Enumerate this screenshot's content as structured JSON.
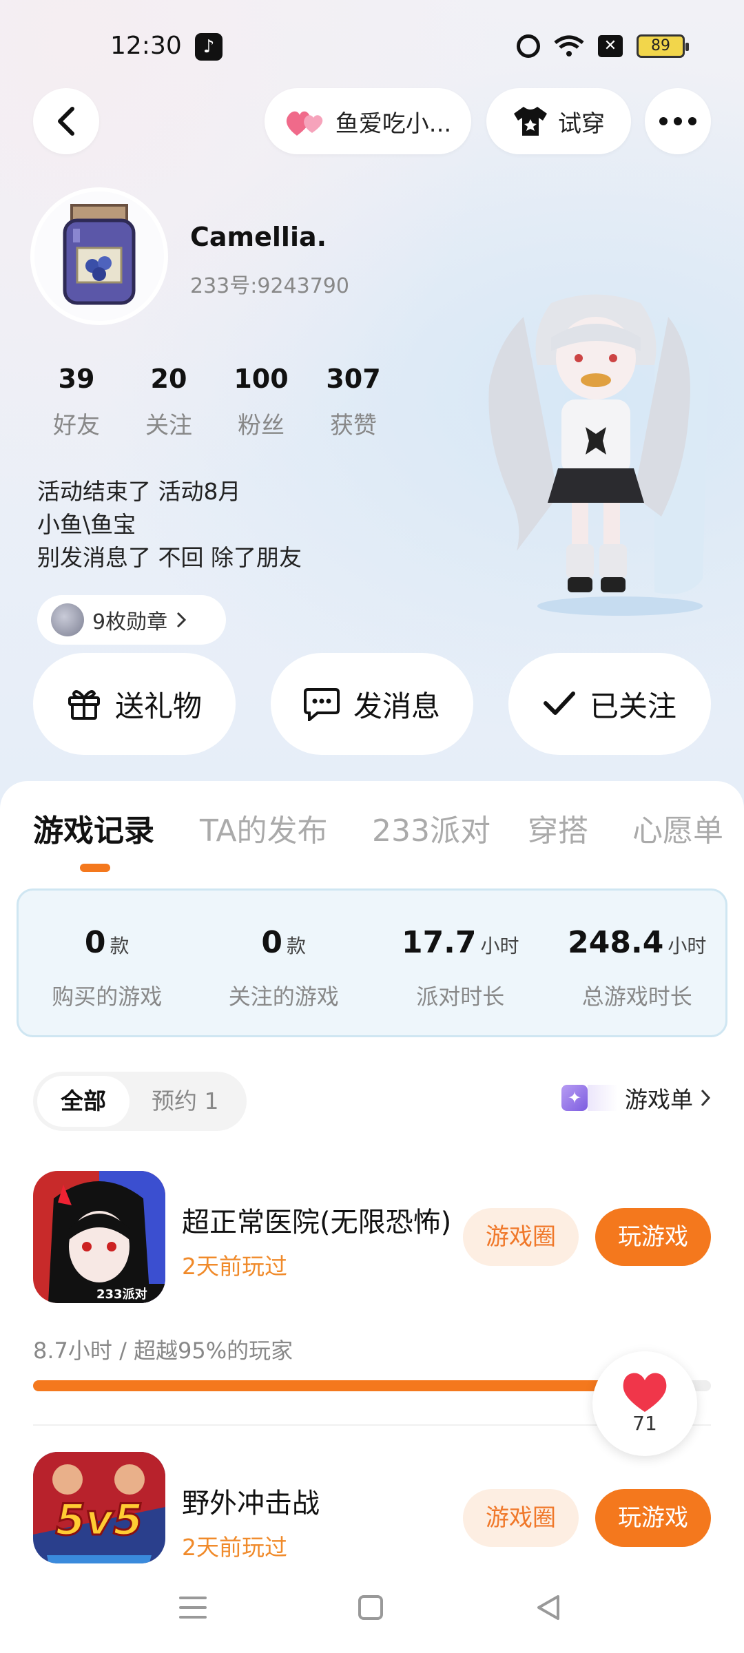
{
  "status_bar": {
    "time": "12:30",
    "battery": "89"
  },
  "top_bar": {
    "nickname_chip": "鱼爱吃小...",
    "try_on": "试穿"
  },
  "profile": {
    "name": "Camellia.",
    "uid": "233号:9243790",
    "stats": [
      {
        "value": "39",
        "label": "好友"
      },
      {
        "value": "20",
        "label": "关注"
      },
      {
        "value": "100",
        "label": "粉丝"
      },
      {
        "value": "307",
        "label": "获赞"
      }
    ],
    "bio": [
      "活动结束了 活动8月",
      "小鱼\\鱼宝",
      "别发消息了 不回 除了朋友"
    ],
    "badges": "9枚勋章"
  },
  "actions": {
    "gift": "送礼物",
    "message": "发消息",
    "followed": "已关注"
  },
  "tabs": [
    "游戏记录",
    "TA的发布",
    "233派对",
    "穿搭",
    "心愿单"
  ],
  "summary": [
    {
      "value": "0",
      "unit": "款",
      "label": "购买的游戏"
    },
    {
      "value": "0",
      "unit": "款",
      "label": "关注的游戏"
    },
    {
      "value": "17.7",
      "unit": "小时",
      "label": "派对时长"
    },
    {
      "value": "248.4",
      "unit": "小时",
      "label": "总游戏时长"
    }
  ],
  "filter": {
    "all": "全部",
    "reserve": "预约 1",
    "game_list": "游戏单"
  },
  "games": [
    {
      "title": "超正常医院(无限恐怖)",
      "last_played": "2天前玩过",
      "circle": "游戏圈",
      "play": "玩游戏",
      "icon_badge": "233派对",
      "play_stat": "8.7小时 / 超越95%的玩家",
      "progress": 0.95
    },
    {
      "title": "野外冲击战",
      "last_played": "2天前玩过",
      "circle": "游戏圈",
      "play": "玩游戏",
      "icon_badge": "5v5"
    }
  ],
  "like_count": "71",
  "colors": {
    "accent": "#f4781d",
    "like": "#f0364a"
  }
}
